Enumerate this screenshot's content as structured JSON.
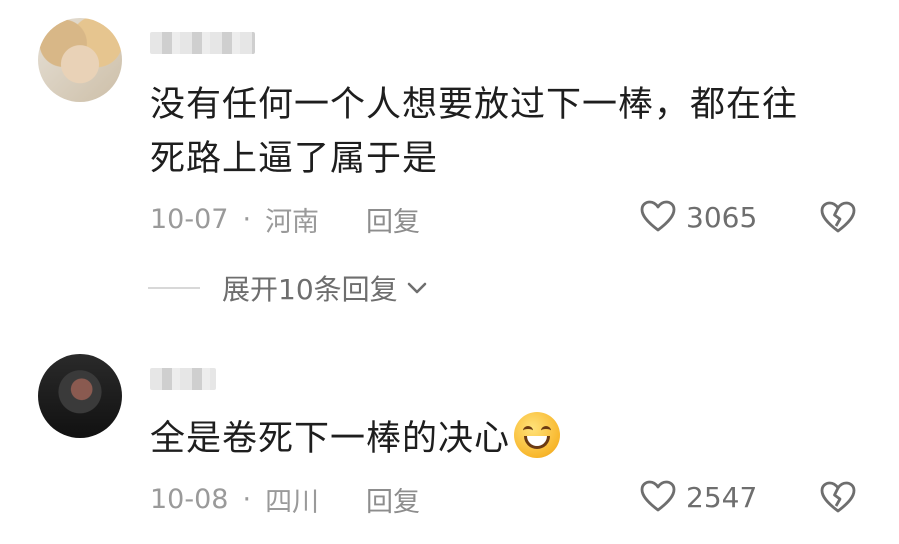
{
  "comments": [
    {
      "text_line1": "没有任何一个人想要放过下一棒，都在往",
      "text_line2": "死路上逼了属于是",
      "date": "10-07",
      "separator": "·",
      "location": "河南",
      "reply_label": "回复",
      "likes": "3065",
      "expand_label": "展开10条回复"
    },
    {
      "text": "全是卷死下一棒的决心",
      "emoji": "grinning-emoji",
      "date": "10-08",
      "separator": "·",
      "location": "四川",
      "reply_label": "回复",
      "likes": "2547"
    }
  ],
  "colors": {
    "text": "#1e1e1e",
    "meta": "#9a9a9a",
    "icon": "#6e6e6e"
  }
}
